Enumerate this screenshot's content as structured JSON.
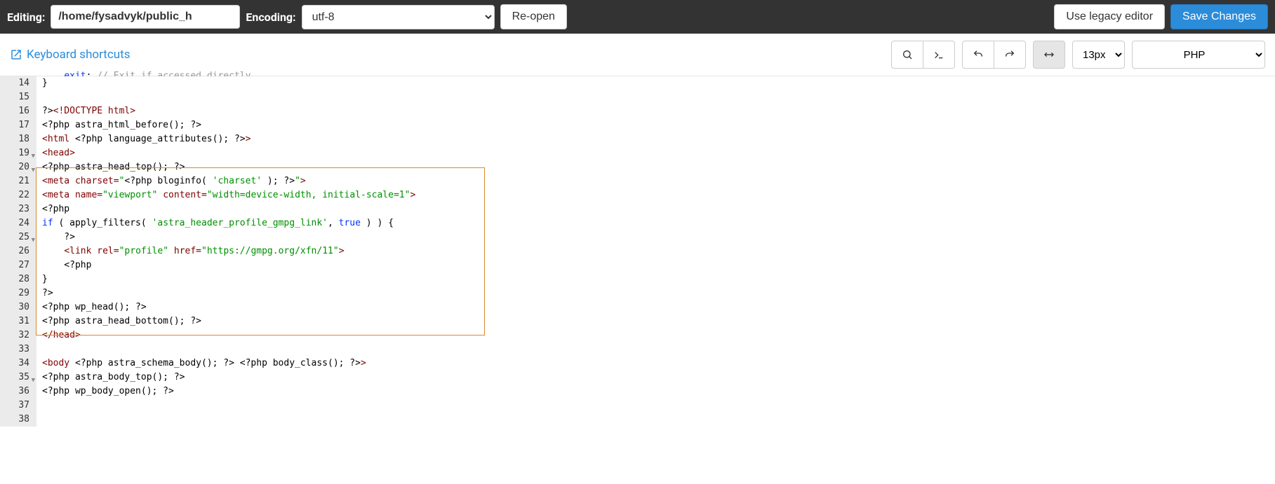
{
  "topbar": {
    "editing_label": "Editing:",
    "path": "/home/fysadvyk/public_h",
    "encoding_label": "Encoding:",
    "encoding_value": "utf-8",
    "reopen_label": "Re-open",
    "legacy_label": "Use legacy editor",
    "save_label": "Save Changes"
  },
  "toolbar": {
    "keyboard_shortcuts": "Keyboard shortcuts",
    "font_size": "13px",
    "language": "PHP"
  },
  "editor": {
    "lines": [
      {
        "n": 14,
        "cutoff": true,
        "html": "    <span class='kw'>exit</span>; <span class='comment'>// Exit if accessed directly.</span>"
      },
      {
        "n": 15,
        "html": "}"
      },
      {
        "n": 16,
        "html": ""
      },
      {
        "n": 17,
        "html": "?&gt;<span class='tag'>&lt;!DOCTYPE html&gt;</span>"
      },
      {
        "n": 18,
        "html": "&lt;?php astra_html_before(); ?&gt;"
      },
      {
        "n": 19,
        "fold": true,
        "html": "<span class='tag'>&lt;html</span> &lt;?php language_attributes(); ?&gt;<span class='tag'>&gt;</span>"
      },
      {
        "n": 20,
        "fold": true,
        "html": "<span class='tag'>&lt;head&gt;</span>"
      },
      {
        "n": 21,
        "sel": true,
        "html": "&lt;?php astra_head_top(); ?&gt;"
      },
      {
        "n": 22,
        "sel": true,
        "html": "<span class='tag'>&lt;meta</span> <span class='attr'>charset=</span><span class='str'>\"</span>&lt;?php bloginfo( <span class='str'>'charset'</span> ); ?&gt;<span class='str'>\"</span><span class='tag'>&gt;</span>"
      },
      {
        "n": 23,
        "sel": true,
        "html": "<span class='tag'>&lt;meta</span> <span class='attr'>name=</span><span class='str'>\"viewport\"</span> <span class='attr'>content=</span><span class='str'>\"width=device-width, initial-scale=1\"</span><span class='tag'>&gt;</span>"
      },
      {
        "n": 24,
        "sel": true,
        "html": "&lt;?php"
      },
      {
        "n": 25,
        "sel": true,
        "fold": true,
        "html": "<span class='kw'>if</span> ( apply_filters( <span class='str'>'astra_header_profile_gmpg_link'</span>, <span class='const'>true</span> ) ) {"
      },
      {
        "n": 26,
        "sel": true,
        "html": "    ?&gt;"
      },
      {
        "n": 27,
        "sel": true,
        "html": "    <span class='tag'>&lt;link</span> <span class='attr'>rel=</span><span class='str'>\"profile\"</span> <span class='attr'>href=</span><span class='str'>\"https://gmpg.org/xfn/11\"</span><span class='tag'>&gt;</span>"
      },
      {
        "n": 28,
        "sel": true,
        "html": "    &lt;?php"
      },
      {
        "n": 29,
        "sel": true,
        "html": "}"
      },
      {
        "n": 30,
        "sel": true,
        "html": "?&gt;"
      },
      {
        "n": 31,
        "sel": true,
        "html": "&lt;?php wp_head(); ?&gt;"
      },
      {
        "n": 32,
        "sel": true,
        "html": "&lt;?php astra_head_bottom(); ?&gt;"
      },
      {
        "n": 33,
        "html": "<span class='tag'>&lt;/head&gt;</span>"
      },
      {
        "n": 34,
        "html": ""
      },
      {
        "n": 35,
        "fold": true,
        "html": "<span class='tag'>&lt;body</span> &lt;?php astra_schema_body(); ?&gt; &lt;?php body_class(); ?&gt;<span class='tag'>&gt;</span>"
      },
      {
        "n": 36,
        "html": "&lt;?php astra_body_top(); ?&gt;"
      },
      {
        "n": 37,
        "html": "&lt;?php wp_body_open(); ?&gt;"
      },
      {
        "n": 38,
        "html": ""
      }
    ]
  }
}
